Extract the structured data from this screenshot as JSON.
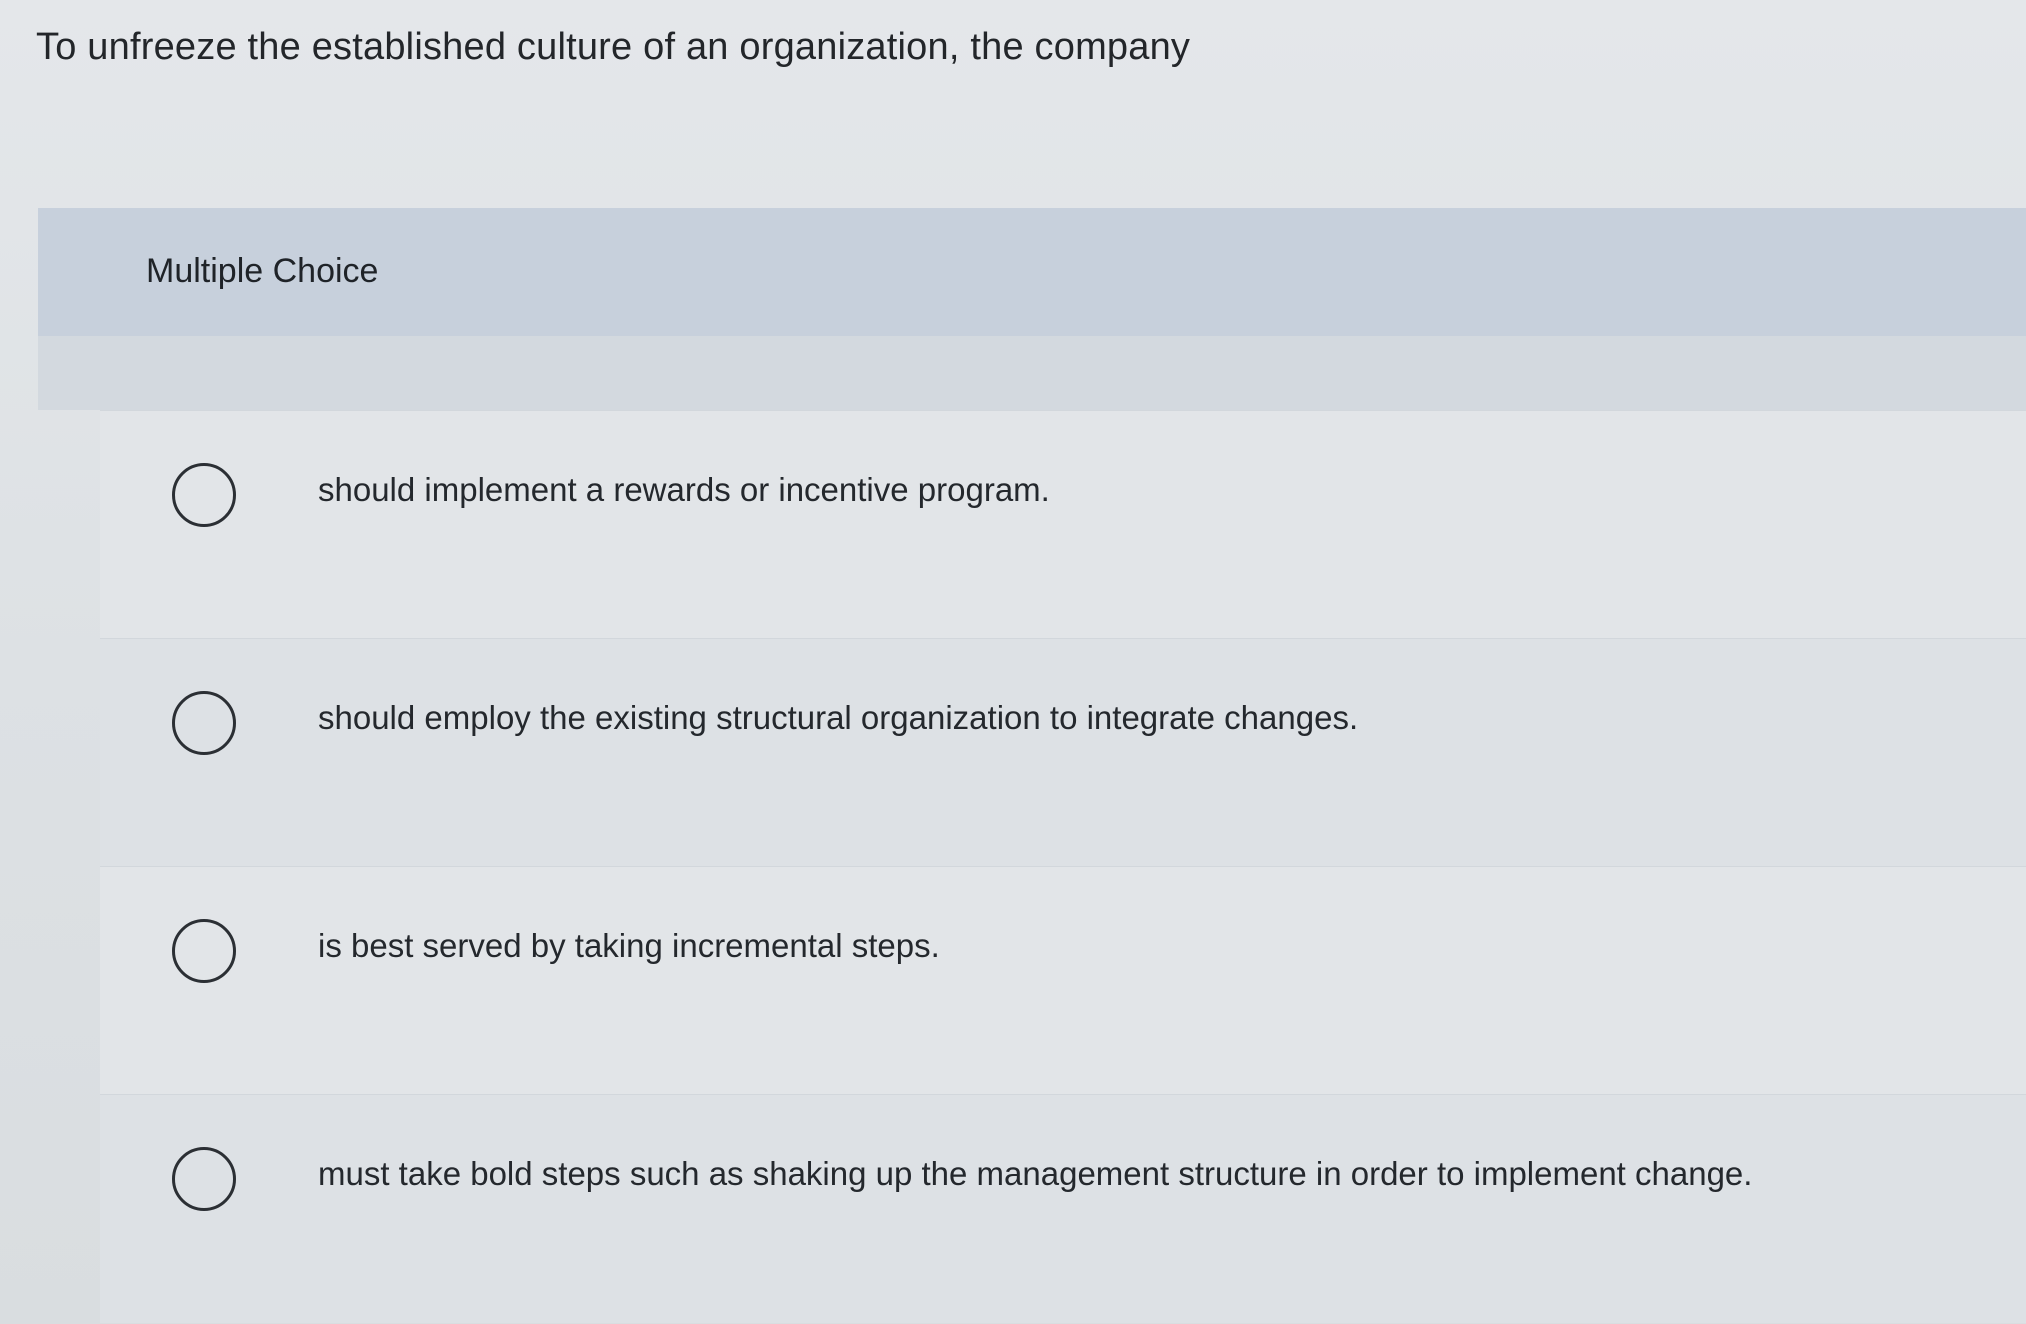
{
  "question": {
    "text": "To unfreeze the established culture of an organization, the company"
  },
  "multiple_choice": {
    "title": "Multiple Choice",
    "options": [
      {
        "label": "should implement a rewards or incentive program."
      },
      {
        "label": "should employ the existing structural organization to integrate changes."
      },
      {
        "label": "is best served by taking incremental steps."
      },
      {
        "label": "must take bold steps such as shaking up the management structure in order to implement change."
      }
    ]
  },
  "colors": {
    "header_band": "#c7d0dc",
    "text": "#23262a",
    "radio_border": "#2b2f34"
  }
}
